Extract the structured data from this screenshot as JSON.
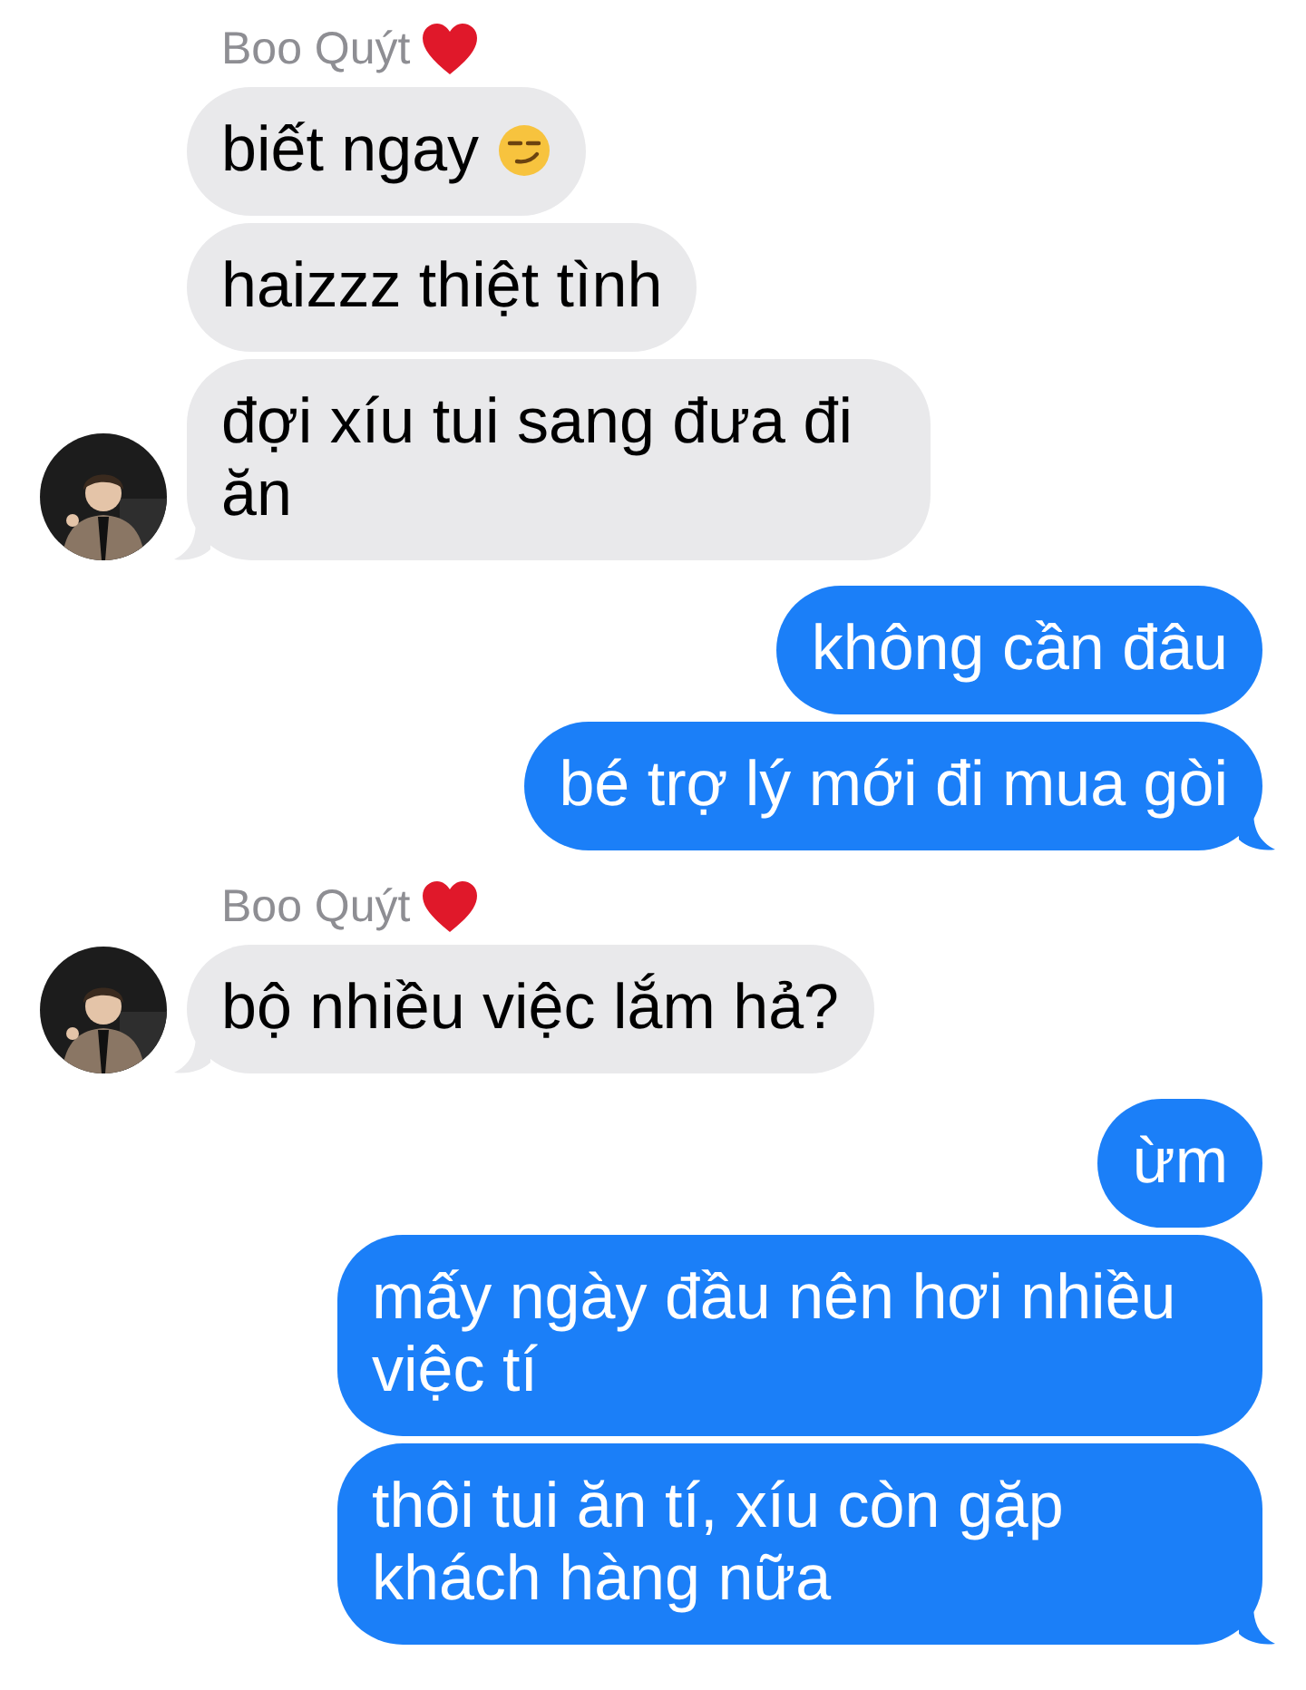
{
  "conversation": [
    {
      "outgoing": false,
      "sender": "Boo Quýt",
      "sender_heart": true,
      "avatar": {
        "kind": "picture"
      },
      "messages": [
        {
          "text": "biết ngay",
          "emoji": true
        },
        {
          "text": "haizzz thiệt tình"
        },
        {
          "text": "đợi xíu tui sang đưa đi ăn"
        }
      ]
    },
    {
      "outgoing": true,
      "messages": [
        {
          "text": "không cần đâu"
        },
        {
          "text": "bé trợ lý mới đi mua gòi"
        }
      ]
    },
    {
      "outgoing": false,
      "sender": "Boo Quýt",
      "sender_heart": true,
      "avatar": {
        "kind": "picture"
      },
      "messages": [
        {
          "text": "bộ nhiều việc lắm hả?"
        }
      ]
    },
    {
      "outgoing": true,
      "messages": [
        {
          "text": "ừm"
        },
        {
          "text": "mấy ngày đầu nên hơi nhiều việc tí"
        },
        {
          "text": "thôi tui ăn tí, xíu còn gặp khách hàng nữa"
        }
      ]
    }
  ]
}
